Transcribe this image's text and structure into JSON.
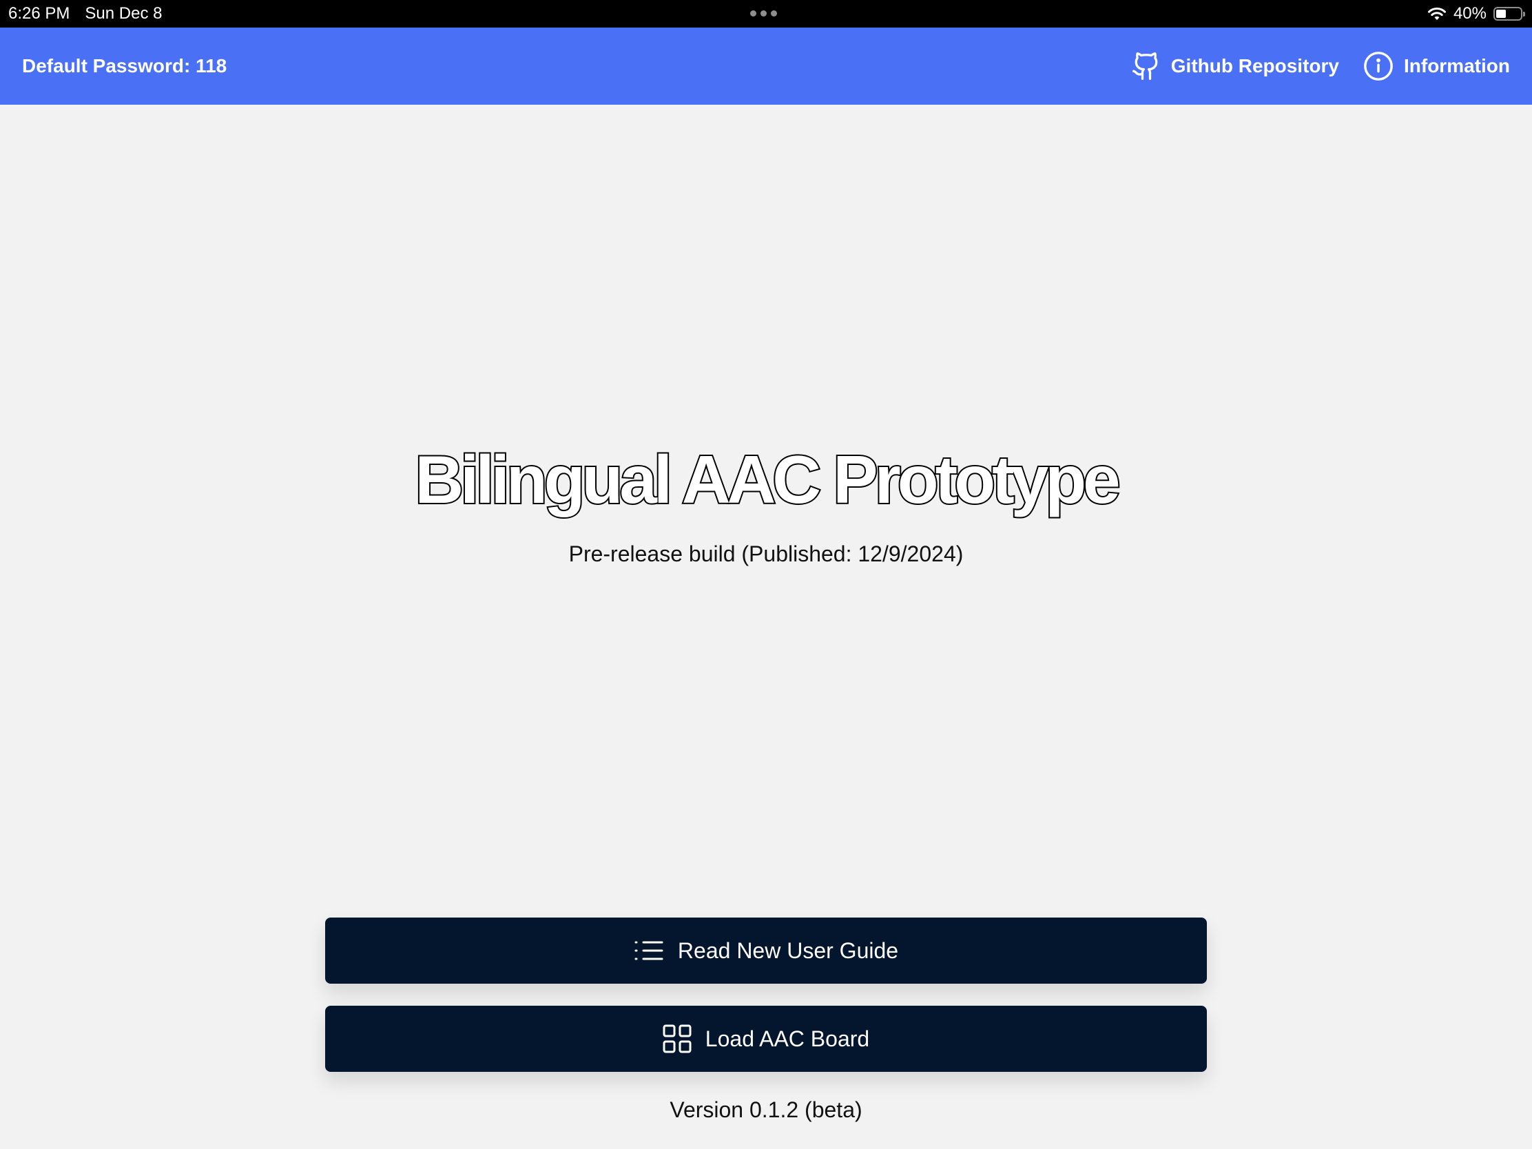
{
  "status_bar": {
    "time": "6:26 PM",
    "date": "Sun Dec 8",
    "battery_text": "40%",
    "battery_level": 0.4
  },
  "header": {
    "password_text": "Default Password: 118",
    "github_label": "Github Repository",
    "github_icon": "github-icon",
    "info_label": "Information",
    "info_icon": "info-circle-icon",
    "background_color": "#4a71f5"
  },
  "main": {
    "title": "Bilingual AAC Prototype",
    "subtitle": "Pre-release build (Published: 12/9/2024)"
  },
  "actions": {
    "guide_label": "Read New User Guide",
    "guide_icon": "list-icon",
    "board_label": "Load AAC Board",
    "board_icon": "grid-icon",
    "button_color": "#04152e"
  },
  "footer": {
    "version": "Version 0.1.2 (beta)"
  }
}
